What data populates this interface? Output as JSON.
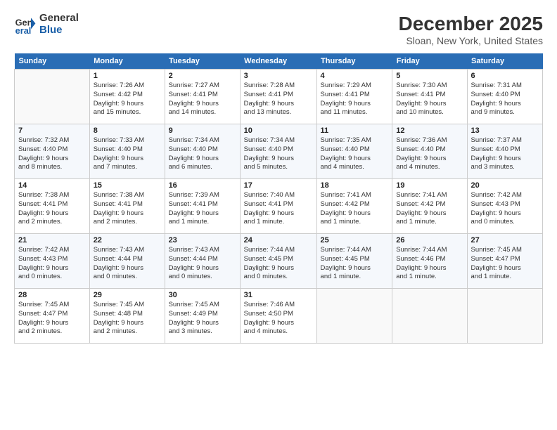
{
  "header": {
    "logo_line1": "General",
    "logo_line2": "Blue",
    "month": "December 2025",
    "location": "Sloan, New York, United States"
  },
  "weekdays": [
    "Sunday",
    "Monday",
    "Tuesday",
    "Wednesday",
    "Thursday",
    "Friday",
    "Saturday"
  ],
  "weeks": [
    [
      {
        "day": "",
        "info": ""
      },
      {
        "day": "1",
        "info": "Sunrise: 7:26 AM\nSunset: 4:42 PM\nDaylight: 9 hours\nand 15 minutes."
      },
      {
        "day": "2",
        "info": "Sunrise: 7:27 AM\nSunset: 4:41 PM\nDaylight: 9 hours\nand 14 minutes."
      },
      {
        "day": "3",
        "info": "Sunrise: 7:28 AM\nSunset: 4:41 PM\nDaylight: 9 hours\nand 13 minutes."
      },
      {
        "day": "4",
        "info": "Sunrise: 7:29 AM\nSunset: 4:41 PM\nDaylight: 9 hours\nand 11 minutes."
      },
      {
        "day": "5",
        "info": "Sunrise: 7:30 AM\nSunset: 4:41 PM\nDaylight: 9 hours\nand 10 minutes."
      },
      {
        "day": "6",
        "info": "Sunrise: 7:31 AM\nSunset: 4:40 PM\nDaylight: 9 hours\nand 9 minutes."
      }
    ],
    [
      {
        "day": "7",
        "info": "Sunrise: 7:32 AM\nSunset: 4:40 PM\nDaylight: 9 hours\nand 8 minutes."
      },
      {
        "day": "8",
        "info": "Sunrise: 7:33 AM\nSunset: 4:40 PM\nDaylight: 9 hours\nand 7 minutes."
      },
      {
        "day": "9",
        "info": "Sunrise: 7:34 AM\nSunset: 4:40 PM\nDaylight: 9 hours\nand 6 minutes."
      },
      {
        "day": "10",
        "info": "Sunrise: 7:34 AM\nSunset: 4:40 PM\nDaylight: 9 hours\nand 5 minutes."
      },
      {
        "day": "11",
        "info": "Sunrise: 7:35 AM\nSunset: 4:40 PM\nDaylight: 9 hours\nand 4 minutes."
      },
      {
        "day": "12",
        "info": "Sunrise: 7:36 AM\nSunset: 4:40 PM\nDaylight: 9 hours\nand 4 minutes."
      },
      {
        "day": "13",
        "info": "Sunrise: 7:37 AM\nSunset: 4:40 PM\nDaylight: 9 hours\nand 3 minutes."
      }
    ],
    [
      {
        "day": "14",
        "info": "Sunrise: 7:38 AM\nSunset: 4:41 PM\nDaylight: 9 hours\nand 2 minutes."
      },
      {
        "day": "15",
        "info": "Sunrise: 7:38 AM\nSunset: 4:41 PM\nDaylight: 9 hours\nand 2 minutes."
      },
      {
        "day": "16",
        "info": "Sunrise: 7:39 AM\nSunset: 4:41 PM\nDaylight: 9 hours\nand 1 minute."
      },
      {
        "day": "17",
        "info": "Sunrise: 7:40 AM\nSunset: 4:41 PM\nDaylight: 9 hours\nand 1 minute."
      },
      {
        "day": "18",
        "info": "Sunrise: 7:41 AM\nSunset: 4:42 PM\nDaylight: 9 hours\nand 1 minute."
      },
      {
        "day": "19",
        "info": "Sunrise: 7:41 AM\nSunset: 4:42 PM\nDaylight: 9 hours\nand 1 minute."
      },
      {
        "day": "20",
        "info": "Sunrise: 7:42 AM\nSunset: 4:43 PM\nDaylight: 9 hours\nand 0 minutes."
      }
    ],
    [
      {
        "day": "21",
        "info": "Sunrise: 7:42 AM\nSunset: 4:43 PM\nDaylight: 9 hours\nand 0 minutes."
      },
      {
        "day": "22",
        "info": "Sunrise: 7:43 AM\nSunset: 4:44 PM\nDaylight: 9 hours\nand 0 minutes."
      },
      {
        "day": "23",
        "info": "Sunrise: 7:43 AM\nSunset: 4:44 PM\nDaylight: 9 hours\nand 0 minutes."
      },
      {
        "day": "24",
        "info": "Sunrise: 7:44 AM\nSunset: 4:45 PM\nDaylight: 9 hours\nand 0 minutes."
      },
      {
        "day": "25",
        "info": "Sunrise: 7:44 AM\nSunset: 4:45 PM\nDaylight: 9 hours\nand 1 minute."
      },
      {
        "day": "26",
        "info": "Sunrise: 7:44 AM\nSunset: 4:46 PM\nDaylight: 9 hours\nand 1 minute."
      },
      {
        "day": "27",
        "info": "Sunrise: 7:45 AM\nSunset: 4:47 PM\nDaylight: 9 hours\nand 1 minute."
      }
    ],
    [
      {
        "day": "28",
        "info": "Sunrise: 7:45 AM\nSunset: 4:47 PM\nDaylight: 9 hours\nand 2 minutes."
      },
      {
        "day": "29",
        "info": "Sunrise: 7:45 AM\nSunset: 4:48 PM\nDaylight: 9 hours\nand 2 minutes."
      },
      {
        "day": "30",
        "info": "Sunrise: 7:45 AM\nSunset: 4:49 PM\nDaylight: 9 hours\nand 3 minutes."
      },
      {
        "day": "31",
        "info": "Sunrise: 7:46 AM\nSunset: 4:50 PM\nDaylight: 9 hours\nand 4 minutes."
      },
      {
        "day": "",
        "info": ""
      },
      {
        "day": "",
        "info": ""
      },
      {
        "day": "",
        "info": ""
      }
    ]
  ]
}
